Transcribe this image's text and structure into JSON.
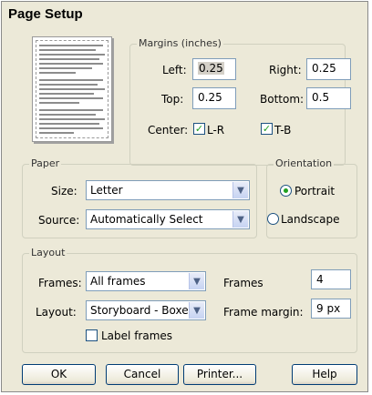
{
  "window": {
    "title": "Page Setup"
  },
  "margins": {
    "legend": "Margins (inches)",
    "left_label": "Left:",
    "left_value": "0.25",
    "right_label": "Right:",
    "right_value": "0.25",
    "top_label": "Top:",
    "top_value": "0.25",
    "bottom_label": "Bottom:",
    "bottom_value": "0.5",
    "center_label": "Center:",
    "lr_label": "L-R",
    "lr_checked": true,
    "tb_label": "T-B",
    "tb_checked": true
  },
  "paper": {
    "legend": "Paper",
    "size_label": "Size:",
    "size_value": "Letter",
    "source_label": "Source:",
    "source_value": "Automatically Select"
  },
  "orientation": {
    "legend": "Orientation",
    "portrait_label": "Portrait",
    "landscape_label": "Landscape",
    "selected": "Portrait"
  },
  "layout": {
    "legend": "Layout",
    "frames_label": "Frames:",
    "frames_value": "All frames",
    "layout_label": "Layout:",
    "layout_value": "Storyboard - Boxes",
    "frames_count_label": "Frames",
    "frames_count_value": "4",
    "frame_margin_label": "Frame margin:",
    "frame_margin_value": "9 px",
    "label_frames_label": "Label frames",
    "label_frames_checked": false
  },
  "buttons": {
    "ok": "OK",
    "cancel": "Cancel",
    "printer": "Printer...",
    "help": "Help"
  },
  "colors": {
    "dialog_bg": "#ece9d8",
    "check_green": "#21a121",
    "field_border": "#7f9db9"
  }
}
